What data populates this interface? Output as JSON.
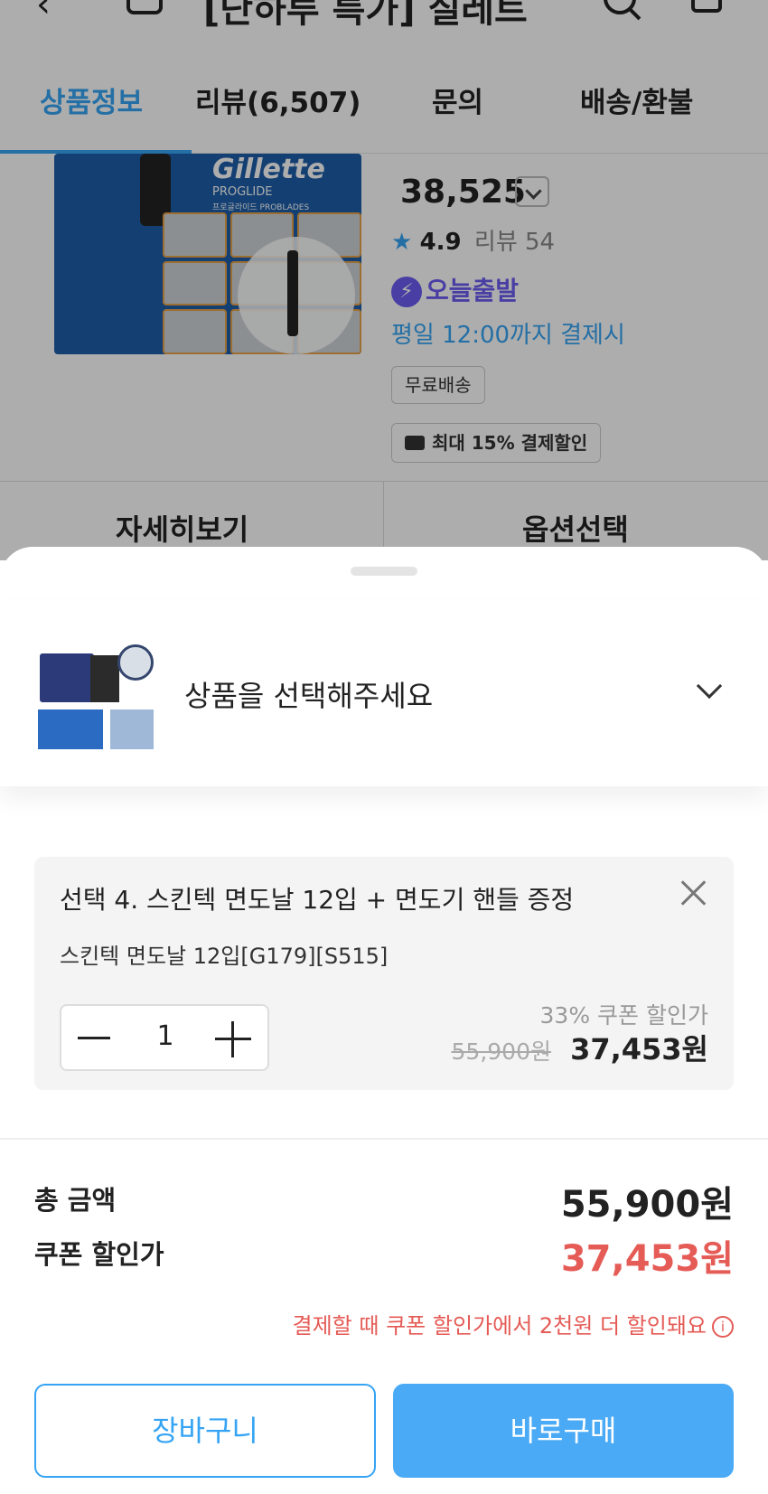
{
  "colors": {
    "accent": "#35a4f4",
    "discount": "#e55b56",
    "today": "#6b5cf0"
  },
  "topbar": {
    "back_icon": "back-arrow-icon",
    "home_icon": "home-icon",
    "title": "[단하루 특가] 질레트",
    "search_icon": "search-icon",
    "cart_icon": "cart-icon"
  },
  "tabs": [
    {
      "label": "상품정보",
      "active": true
    },
    {
      "label": "리뷰(6,507)"
    },
    {
      "label": "문의"
    },
    {
      "label": "배송/환불"
    }
  ],
  "product": {
    "image_brand": "Gillette",
    "image_sub": "PROGLIDE",
    "image_sub2": "프로글라이드 PROBLADES",
    "price": "38,525",
    "rating_star": "★",
    "rating": "4.9",
    "review_count": "리뷰 54",
    "today_badge": "오늘출발",
    "today_bolt": "⚡",
    "deadline": "평일 12:00까지 결제시",
    "free_shipping": "무료배송",
    "payment_discount": "최대 15% 결제할인"
  },
  "bottom_nav": {
    "detail": "자세히보기",
    "option": "옵션선택"
  },
  "sheet": {
    "selector_placeholder": "상품을 선택해주세요",
    "option": {
      "title": "선택 4. 스킨텍 면도날 12입 + 면도기 핸들 증정",
      "subtitle": "스킨텍 면도날 12입[G179][S515]",
      "quantity": "1",
      "discount_label": "33% 쿠폰 할인가",
      "original_price": "55,900원",
      "final_price": "37,453원"
    },
    "total_label": "총 금액",
    "total_value": "55,900원",
    "coupon_label": "쿠폰 할인가",
    "coupon_value": "37,453원",
    "note": "결제할 때 쿠폰 할인가에서 2천원 더 할인돼요",
    "note_icon": "i",
    "cart_button": "장바구니",
    "buy_button": "바로구매"
  }
}
